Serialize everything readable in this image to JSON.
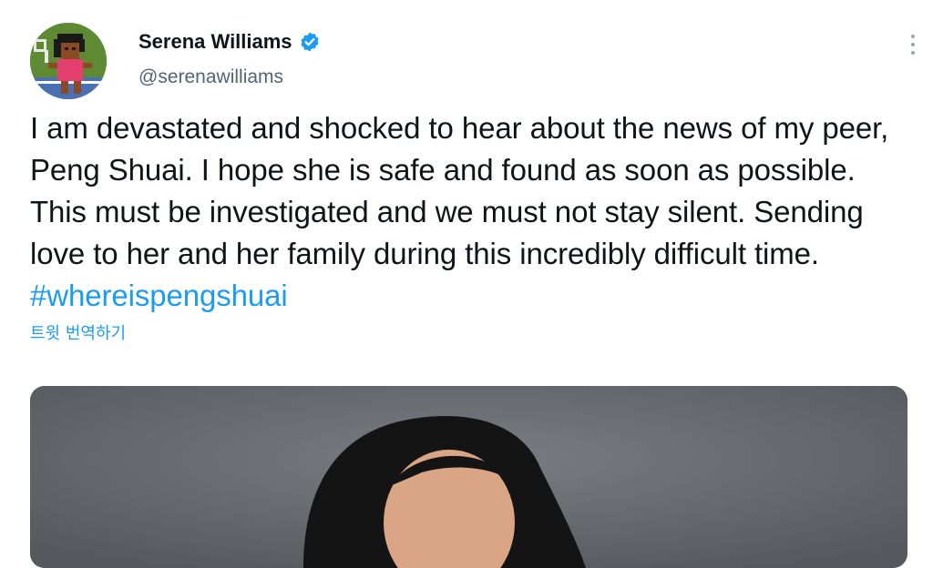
{
  "author": {
    "name": "Serena Williams",
    "handle": "@serenawilliams",
    "verified": true,
    "avatar_icon": "pixel-tennis-player-avatar",
    "verified_icon": "verified-badge-icon"
  },
  "tweet": {
    "text_before": "I am devastated and shocked to hear about the news of my peer, Peng Shuai. I hope she is safe and found as soon as possible. This must be investigated and we must not stay silent. Sending love to her and her family during this incredibly difficult time.",
    "hashtag": "#whereispengshuai",
    "translate_label": "트윗 번역하기"
  },
  "media": {
    "description_icon": "photo-image"
  },
  "menu": {
    "icon": "more-options-icon"
  },
  "colors": {
    "accent": "#1d9bf0",
    "secondary_text": "#536471",
    "primary_text": "#0f1419"
  }
}
